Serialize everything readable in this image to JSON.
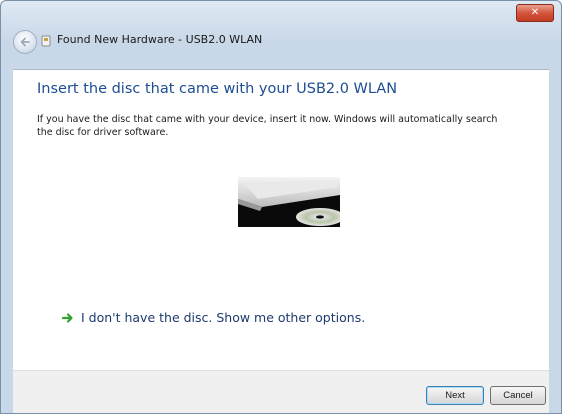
{
  "window": {
    "title": "Found New Hardware - USB2.0 WLAN",
    "close_glyph": "✕"
  },
  "main": {
    "heading": "Insert the disc that came with your USB2.0 WLAN",
    "instructions": "If you have the disc that came with your device, insert it now. Windows will automatically search the disc for driver software.",
    "option_text": "I don't have the disc. Show me other options."
  },
  "footer": {
    "next_label": "Next",
    "cancel_label": "Cancel"
  },
  "colors": {
    "heading": "#1e4d93",
    "link_arrow": "#2ea12e",
    "close_button": "#d4553c"
  }
}
